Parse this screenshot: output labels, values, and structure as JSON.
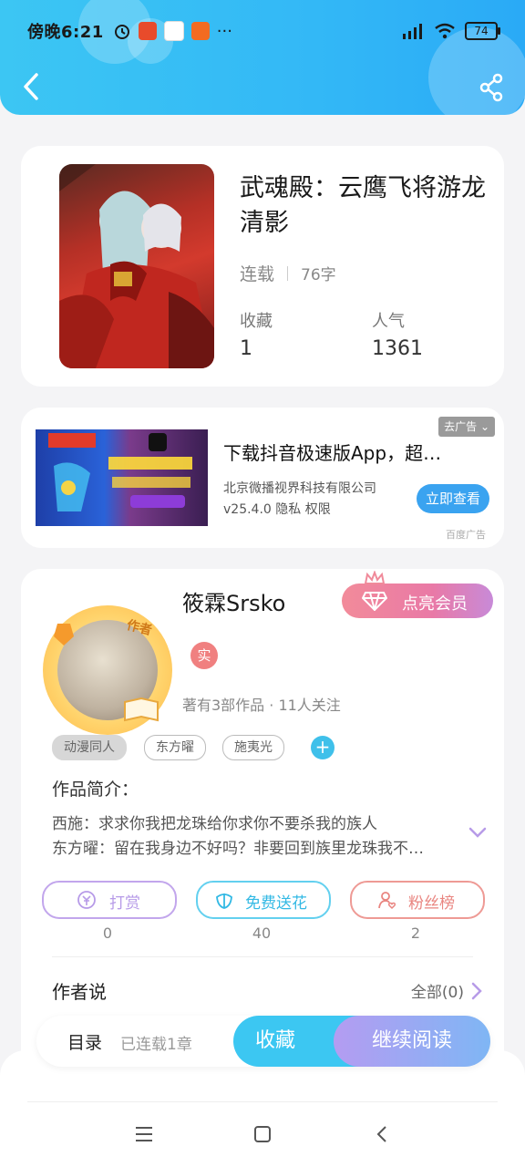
{
  "status_bar": {
    "time": "傍晚6:21",
    "more": "···",
    "battery": "74"
  },
  "book": {
    "title": "武魂殿：云鹰飞将游龙清影",
    "status": "连载",
    "word_count": "76字",
    "favorites_label": "收藏",
    "favorites_value": "1",
    "popularity_label": "人气",
    "popularity_value": "1361"
  },
  "ad": {
    "close_label": "去广告",
    "title": "下载抖音极速版App，超…",
    "company": "北京微播视界科技有限公司",
    "version": "v25.4.0  隐私  权限",
    "cta": "立即查看",
    "source": "百度广告"
  },
  "author": {
    "badge": "作者",
    "name": "筱霖Srsko",
    "vip_label": "点亮会员",
    "verified": "实",
    "subtitle": "著有3部作品 · 11人关注",
    "tags": [
      "动漫同人",
      "东方曜",
      "施夷光"
    ],
    "add_tag": "+",
    "intro_label": "作品简介：",
    "intro_lines": [
      "西施：求求你我把龙珠给你求你不要杀我的族人",
      "东方曜：留在我身边不好吗？非要回到族里龙珠我不…"
    ],
    "actions": [
      {
        "label": "打赏",
        "count": "0"
      },
      {
        "label": "免费送花",
        "count": "40"
      },
      {
        "label": "粉丝榜",
        "count": "2"
      }
    ],
    "author_says": "作者说",
    "all_link": "全部(0)"
  },
  "bottom": {
    "toc": "目录",
    "toc_sub": "已连载1章",
    "fav": "收藏",
    "read": "继续阅读"
  },
  "colors": {
    "header": "#33b8f6",
    "accent": "#3cc7f2",
    "reward": "#b79be8",
    "flower": "#4cc9ea",
    "fans": "#ec8c87"
  }
}
